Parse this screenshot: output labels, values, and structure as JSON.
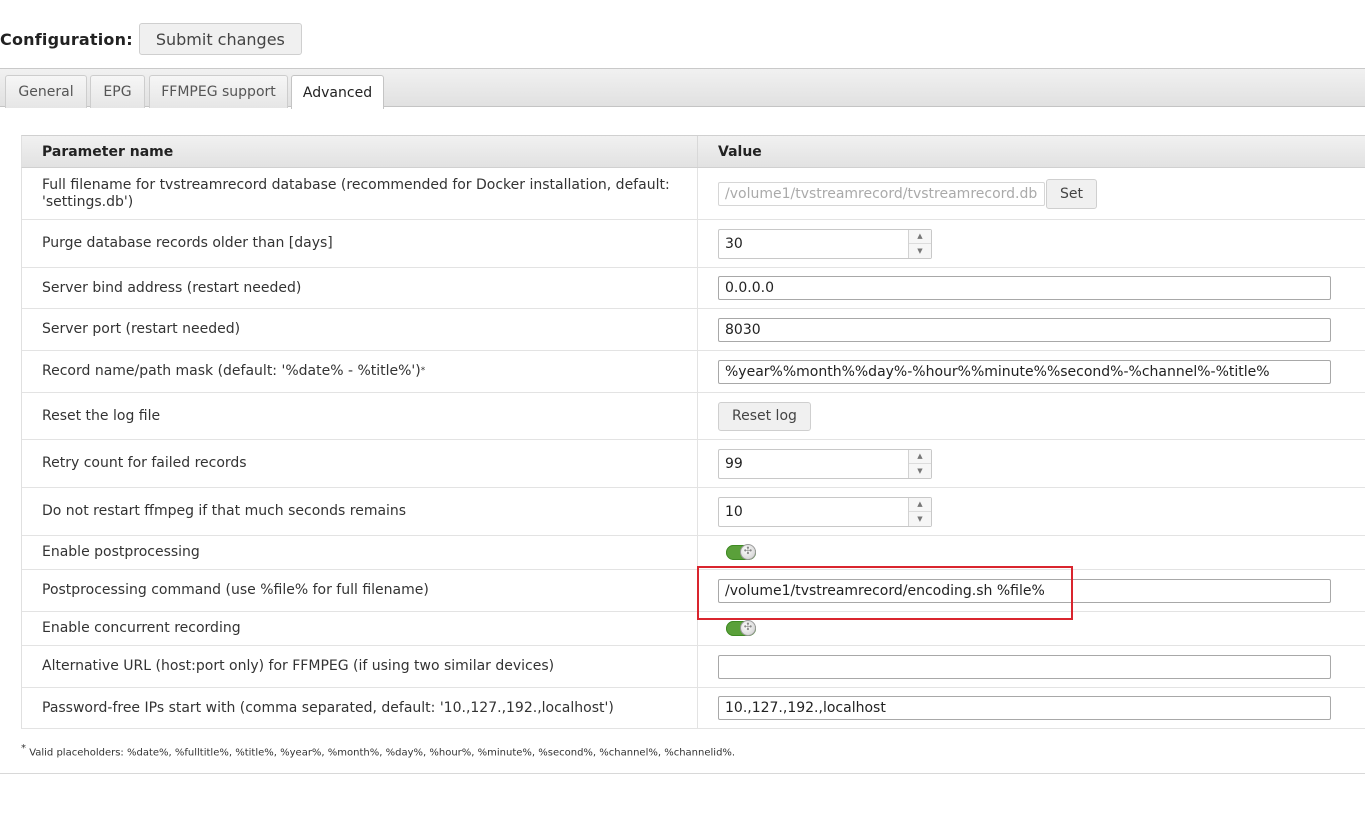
{
  "header": {
    "title": "Configuration:",
    "submit_label": "Submit changes"
  },
  "tabs": [
    {
      "label": "General",
      "active": false
    },
    {
      "label": "EPG",
      "active": false
    },
    {
      "label": "FFMPEG support",
      "active": false
    },
    {
      "label": "Advanced",
      "active": true
    }
  ],
  "table": {
    "col_name": "Parameter name",
    "col_value": "Value",
    "rows": {
      "db_file": {
        "label": "Full filename for tvstreamrecord database (recommended for Docker installation, default: 'settings.db')",
        "placeholder": "/volume1/tvstreamrecord/tvstreamrecord.db",
        "button": "Set"
      },
      "purge": {
        "label": "Purge database records older than [days]",
        "value": "30"
      },
      "bind_address": {
        "label": "Server bind address (restart needed)",
        "value": "0.0.0.0"
      },
      "port": {
        "label": "Server port (restart needed)",
        "value": "8030"
      },
      "mask": {
        "label": "Record name/path mask (default: '%date% - %title%')",
        "marker": "*",
        "value": "%year%%month%%day%-%hour%%minute%%second%-%channel%-%title%"
      },
      "reset_log": {
        "label": "Reset the log file",
        "button": "Reset log"
      },
      "retry": {
        "label": "Retry count for failed records",
        "value": "99"
      },
      "no_restart": {
        "label": "Do not restart ffmpeg if that much seconds remains",
        "value": "10"
      },
      "enable_post": {
        "label": "Enable postprocessing",
        "enabled": true
      },
      "post_cmd": {
        "label": "Postprocessing command (use %file% for full filename)",
        "value": "/volume1/tvstreamrecord/encoding.sh %file%"
      },
      "concurrent": {
        "label": "Enable concurrent recording",
        "enabled": true
      },
      "alt_url": {
        "label": "Alternative URL (host:port only) for FFMPEG (if using two similar devices)",
        "value": ""
      },
      "free_ips": {
        "label": "Password-free IPs start with (comma separated, default: '10.,127.,192.,localhost')",
        "value": "10.,127.,192.,localhost"
      }
    }
  },
  "footnote": {
    "marker": "*",
    "text": "Valid placeholders: %date%, %fulltitle%, %title%, %year%, %month%, %day%, %hour%, %minute%, %second%, %channel%, %channelid%."
  },
  "colors": {
    "highlight": "#d9252e",
    "toggle_on": "#5aa03a"
  },
  "icons": {
    "spinner_up": "caret-up-icon",
    "spinner_down": "caret-down-icon",
    "toggle": "toggle-switch-icon"
  }
}
